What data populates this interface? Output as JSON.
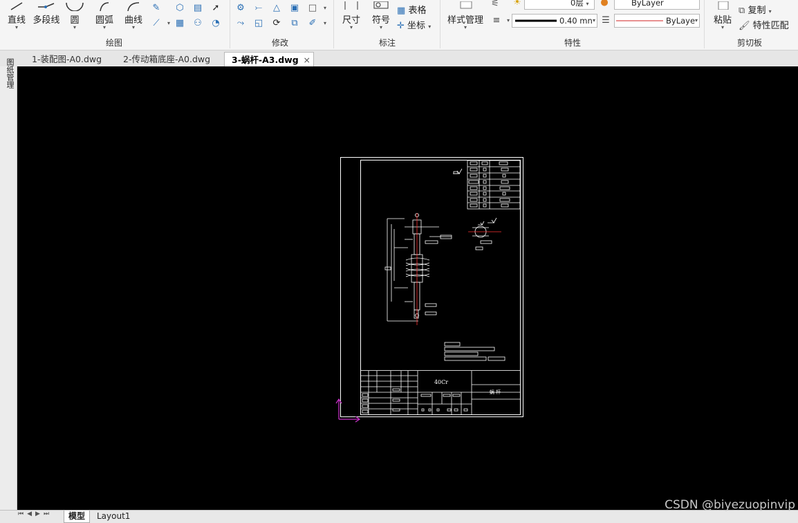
{
  "ribbon": {
    "draw_group": "绘图",
    "modify_group": "修改",
    "annotate_group": "标注",
    "properties_group": "特性",
    "clipboard_group": "剪切板",
    "buttons": {
      "line": "直线",
      "polyline": "多段线",
      "circle": "圆",
      "arc": "圆弧",
      "curve": "曲线",
      "dimension": "尺寸",
      "symbol": "符号",
      "table": "表格",
      "coordinate": "坐标",
      "style_manager": "样式管理",
      "paste": "粘贴",
      "copy": "复制",
      "match_properties": "特性匹配"
    },
    "lineweight_value": "0.40 mn",
    "layer_value": "0层",
    "color_value": "ByLayer",
    "linetype_value": "ByLaye"
  },
  "tabs": [
    {
      "label": "1-装配图-A0.dwg",
      "active": false
    },
    {
      "label": "2-传动箱底座-A0.dwg",
      "active": false
    },
    {
      "label": "3-蜗杆-A3.dwg",
      "active": true
    }
  ],
  "tab_close": "×",
  "leftbar_label": "图纸管理",
  "drawing": {
    "material": "40Cr",
    "part_name": "蜗 杆"
  },
  "bottom": {
    "model_tab": "模型",
    "layout_tab": "Layout1"
  },
  "watermark": "CSDN @biyezuopinvip",
  "colors": {
    "canvas_bg": "#000000",
    "drawing_line": "#ffffff",
    "ucs_icon": "#cc33cc",
    "centerline": "#ff3333"
  }
}
